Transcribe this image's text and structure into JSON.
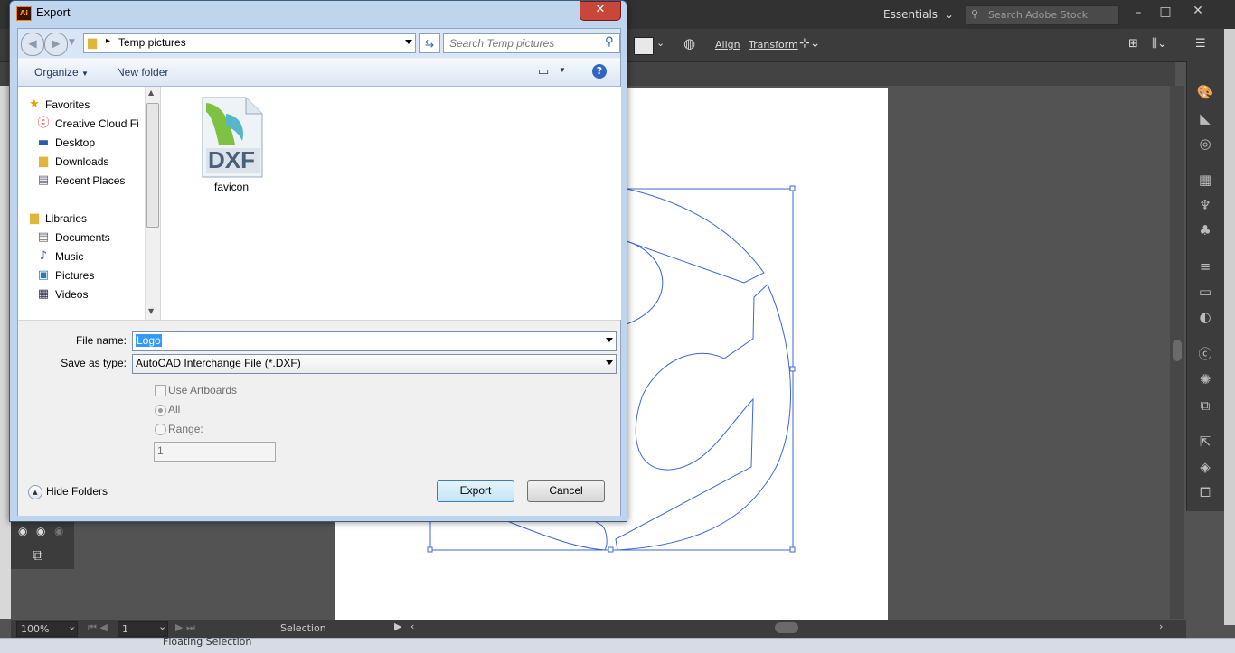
{
  "ai": {
    "workspace": "Essentials",
    "stock_search_placeholder": "Search Adobe Stock",
    "control_links": {
      "align": "Align",
      "transform": "Transform"
    },
    "zoom": "100%",
    "artboard_number": "1",
    "status_tool": "Selection",
    "taskbar_text": "Floating Selection"
  },
  "dialog": {
    "title": "Export",
    "app_badge": "Ai",
    "path": "Temp pictures",
    "search_placeholder": "Search Temp pictures",
    "toolbar": {
      "organize": "Organize",
      "new_folder": "New folder"
    },
    "nav": {
      "favorites_header": "Favorites",
      "favorites": [
        "Creative Cloud Fi",
        "Desktop",
        "Downloads",
        "Recent Places"
      ],
      "libraries_header": "Libraries",
      "libraries": [
        "Documents",
        "Music",
        "Pictures",
        "Videos"
      ]
    },
    "file": {
      "icon_text": "DXF",
      "name": "favicon"
    },
    "file_name_label": "File name:",
    "file_name_value": "Logo",
    "save_type_label": "Save as type:",
    "save_type_value": "AutoCAD Interchange File (*.DXF)",
    "options": {
      "use_artboards": "Use Artboards",
      "all": "All",
      "range": "Range:",
      "range_value": "1"
    },
    "hide_folders": "Hide Folders",
    "export_button": "Export",
    "cancel_button": "Cancel"
  },
  "colors": {
    "selection_blue": "#3b67d6",
    "dialog_frame": "#bfd5ee",
    "close_red": "#c7473b"
  }
}
